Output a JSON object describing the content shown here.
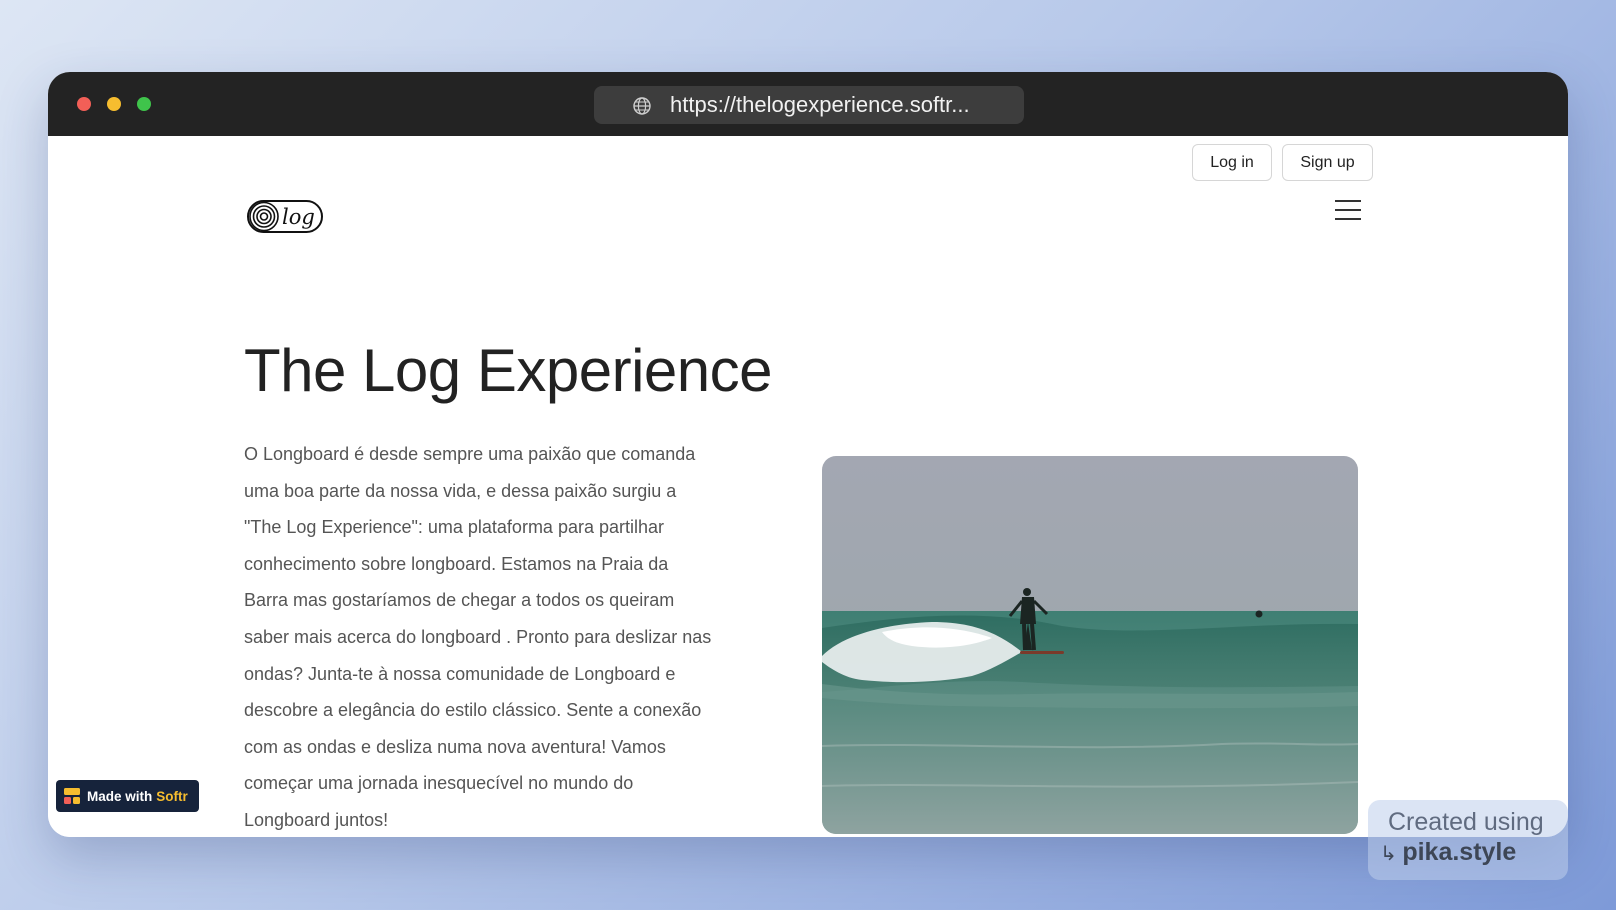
{
  "browser": {
    "url": "https://thelogexperience.softr...",
    "controls": [
      "close",
      "minimize",
      "maximize"
    ]
  },
  "header": {
    "login_label": "Log in",
    "signup_label": "Sign up",
    "logo_text": "log",
    "menu_icon": "hamburger-menu-icon"
  },
  "hero": {
    "title": "The Log Experience",
    "body": "O Longboard é desde sempre uma paixão que comanda uma boa parte da nossa vida, e dessa paixão surgiu a \"The Log Experience\": uma plataforma para partilhar conhecimento sobre longboard. Estamos na Praia da Barra mas gostaríamos de chegar a todos os queiram saber mais acerca do longboard . Pronto para deslizar nas ondas? Junta-te à nossa comunidade de Longboard e descobre a elegância do estilo clássico. Sente a conexão com as ondas e desliza numa nova aventura! Vamos começar uma jornada inesquecível no mundo do Longboard juntos!"
  },
  "badge": {
    "prefix": "Made with",
    "brand": "Softr"
  },
  "watermark": {
    "line1": "Created using",
    "line2": "pika.style"
  },
  "colors": {
    "titlebar": "#232323",
    "badge_bg": "#16233b",
    "badge_brand": "#f6bd2f"
  }
}
